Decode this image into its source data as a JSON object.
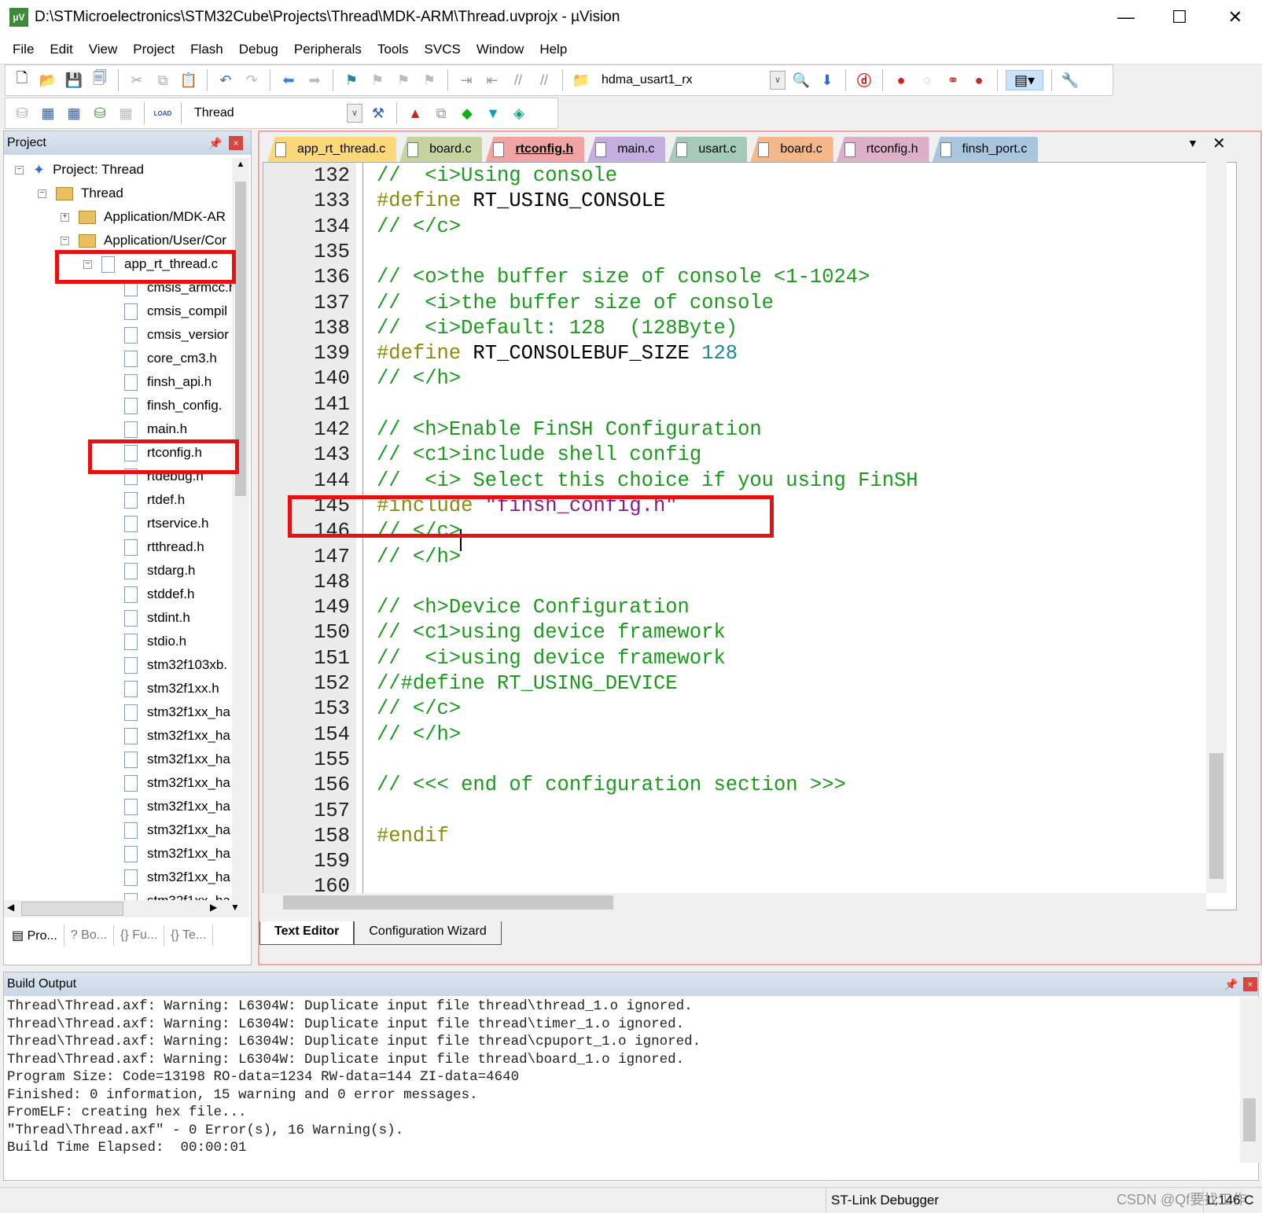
{
  "window": {
    "title": "D:\\STMicroelectronics\\STM32Cube\\Projects\\Thread\\MDK-ARM\\Thread.uvprojx - µVision",
    "minimize": "—",
    "maximize": "☐",
    "close": "✕"
  },
  "menu": [
    "File",
    "Edit",
    "View",
    "Project",
    "Flash",
    "Debug",
    "Peripherals",
    "Tools",
    "SVCS",
    "Window",
    "Help"
  ],
  "toolbar": {
    "find_combo": "hdma_usart1_rx",
    "target_combo": "Thread",
    "load_label": "LOAD"
  },
  "project_panel": {
    "title": "Project",
    "tree": [
      {
        "label": "Project: Thread",
        "level": 0,
        "type": "project",
        "exp": "−"
      },
      {
        "label": "Thread",
        "level": 1,
        "type": "target",
        "exp": "−"
      },
      {
        "label": "Application/MDK-AR",
        "level": 2,
        "type": "folder",
        "exp": "+"
      },
      {
        "label": "Application/User/Cor",
        "level": 2,
        "type": "folder",
        "exp": "−"
      },
      {
        "label": "app_rt_thread.c",
        "level": 3,
        "type": "file",
        "exp": "−"
      },
      {
        "label": "cmsis_armcc.h",
        "level": 4,
        "type": "file"
      },
      {
        "label": "cmsis_compil",
        "level": 4,
        "type": "file"
      },
      {
        "label": "cmsis_versior",
        "level": 4,
        "type": "file"
      },
      {
        "label": "core_cm3.h",
        "level": 4,
        "type": "file"
      },
      {
        "label": "finsh_api.h",
        "level": 4,
        "type": "file"
      },
      {
        "label": "finsh_config.",
        "level": 4,
        "type": "file"
      },
      {
        "label": "main.h",
        "level": 4,
        "type": "file"
      },
      {
        "label": "rtconfig.h",
        "level": 4,
        "type": "file"
      },
      {
        "label": "rtdebug.h",
        "level": 4,
        "type": "file"
      },
      {
        "label": "rtdef.h",
        "level": 4,
        "type": "file"
      },
      {
        "label": "rtservice.h",
        "level": 4,
        "type": "file"
      },
      {
        "label": "rtthread.h",
        "level": 4,
        "type": "file"
      },
      {
        "label": "stdarg.h",
        "level": 4,
        "type": "file"
      },
      {
        "label": "stddef.h",
        "level": 4,
        "type": "file"
      },
      {
        "label": "stdint.h",
        "level": 4,
        "type": "file"
      },
      {
        "label": "stdio.h",
        "level": 4,
        "type": "file"
      },
      {
        "label": "stm32f103xb.",
        "level": 4,
        "type": "file"
      },
      {
        "label": "stm32f1xx.h",
        "level": 4,
        "type": "file"
      },
      {
        "label": "stm32f1xx_ha",
        "level": 4,
        "type": "file"
      },
      {
        "label": "stm32f1xx_ha",
        "level": 4,
        "type": "file"
      },
      {
        "label": "stm32f1xx_ha",
        "level": 4,
        "type": "file"
      },
      {
        "label": "stm32f1xx_ha",
        "level": 4,
        "type": "file"
      },
      {
        "label": "stm32f1xx_ha",
        "level": 4,
        "type": "file"
      },
      {
        "label": "stm32f1xx_ha",
        "level": 4,
        "type": "file"
      },
      {
        "label": "stm32f1xx_ha",
        "level": 4,
        "type": "file"
      },
      {
        "label": "stm32f1xx_ha",
        "level": 4,
        "type": "file"
      },
      {
        "label": "stm32f1xx_ha",
        "level": 4,
        "type": "file"
      }
    ],
    "bottom_tabs": [
      "Pro...",
      "Bo...",
      "Fu...",
      "Te..."
    ]
  },
  "editor": {
    "tabs": [
      {
        "label": "app_rt_thread.c",
        "color": "#fbd97a"
      },
      {
        "label": "board.c",
        "color": "#c5d3a0"
      },
      {
        "label": "rtconfig.h",
        "color": "#f0a4a4",
        "active": true
      },
      {
        "label": "main.c",
        "color": "#c3aee0"
      },
      {
        "label": "usart.c",
        "color": "#a5cbb8"
      },
      {
        "label": "board.c",
        "color": "#f5b88a"
      },
      {
        "label": "rtconfig.h",
        "color": "#dcb0c8"
      },
      {
        "label": "finsh_port.c",
        "color": "#a9c6de"
      }
    ],
    "lines": [
      {
        "n": "132",
        "seg": [
          [
            "c",
            "//  <i>Using console"
          ]
        ]
      },
      {
        "n": "133",
        "seg": [
          [
            "p",
            "#define"
          ],
          [
            "i",
            " RT_USING_CONSOLE"
          ]
        ]
      },
      {
        "n": "134",
        "seg": [
          [
            "c",
            "// </c>"
          ]
        ]
      },
      {
        "n": "135",
        "seg": []
      },
      {
        "n": "136",
        "seg": [
          [
            "c",
            "// <o>the buffer size of console <1-1024>"
          ]
        ]
      },
      {
        "n": "137",
        "seg": [
          [
            "c",
            "//  <i>the buffer size of console"
          ]
        ]
      },
      {
        "n": "138",
        "seg": [
          [
            "c",
            "//  <i>Default: 128  (128Byte)"
          ]
        ]
      },
      {
        "n": "139",
        "seg": [
          [
            "p",
            "#define"
          ],
          [
            "i",
            " RT_CONSOLEBUF_SIZE "
          ],
          [
            "n",
            "128"
          ]
        ]
      },
      {
        "n": "140",
        "seg": [
          [
            "c",
            "// </h>"
          ]
        ]
      },
      {
        "n": "141",
        "seg": []
      },
      {
        "n": "142",
        "seg": [
          [
            "c",
            "// <h>Enable FinSH Configuration"
          ]
        ]
      },
      {
        "n": "143",
        "seg": [
          [
            "c",
            "// <c1>include shell config"
          ]
        ]
      },
      {
        "n": "144",
        "seg": [
          [
            "c",
            "//  <i> Select this choice if you using FinSH"
          ]
        ]
      },
      {
        "n": "145",
        "seg": [
          [
            "p",
            "#include"
          ],
          [
            "i",
            " "
          ],
          [
            "s",
            "\"finsh_config.h\""
          ]
        ]
      },
      {
        "n": "146",
        "seg": [
          [
            "c",
            "// </c>"
          ]
        ]
      },
      {
        "n": "147",
        "seg": [
          [
            "c",
            "// </h>"
          ]
        ]
      },
      {
        "n": "148",
        "seg": []
      },
      {
        "n": "149",
        "seg": [
          [
            "c",
            "// <h>Device Configuration"
          ]
        ]
      },
      {
        "n": "150",
        "seg": [
          [
            "c",
            "// <c1>using device framework"
          ]
        ]
      },
      {
        "n": "151",
        "seg": [
          [
            "c",
            "//  <i>using device framework"
          ]
        ]
      },
      {
        "n": "152",
        "seg": [
          [
            "c",
            "//#define RT_USING_DEVICE"
          ]
        ]
      },
      {
        "n": "153",
        "seg": [
          [
            "c",
            "// </c>"
          ]
        ]
      },
      {
        "n": "154",
        "seg": [
          [
            "c",
            "// </h>"
          ]
        ]
      },
      {
        "n": "155",
        "seg": []
      },
      {
        "n": "156",
        "seg": [
          [
            "c",
            "// <<< end of configuration section >>>"
          ]
        ]
      },
      {
        "n": "157",
        "seg": []
      },
      {
        "n": "158",
        "seg": [
          [
            "p",
            "#endif"
          ]
        ]
      },
      {
        "n": "159",
        "seg": []
      },
      {
        "n": "160",
        "seg": []
      }
    ],
    "bottom_tabs": [
      "Text Editor",
      "Configuration Wizard"
    ]
  },
  "build_output": {
    "title": "Build Output",
    "lines": [
      "Thread\\Thread.axf: Warning: L6304W: Duplicate input file thread\\thread_1.o ignored.",
      "Thread\\Thread.axf: Warning: L6304W: Duplicate input file thread\\timer_1.o ignored.",
      "Thread\\Thread.axf: Warning: L6304W: Duplicate input file thread\\cpuport_1.o ignored.",
      "Thread\\Thread.axf: Warning: L6304W: Duplicate input file thread\\board_1.o ignored.",
      "Program Size: Code=13198 RO-data=1234 RW-data=144 ZI-data=4640",
      "Finished: 0 information, 15 warning and 0 error messages.",
      "FromELF: creating hex file...",
      "\"Thread\\Thread.axf\" - 0 Error(s), 16 Warning(s).",
      "Build Time Elapsed:  00:00:01"
    ]
  },
  "status": {
    "debugger": "ST-Link Debugger",
    "position": "L:146 C",
    "watermark": "CSDN @Qf要找工作"
  },
  "colors": {
    "highlight_box": "#e81010",
    "comment": "#1a9a1a",
    "preprocessor": "#8a8a10",
    "string": "#8a1a8a",
    "number": "#1a8a9a"
  }
}
